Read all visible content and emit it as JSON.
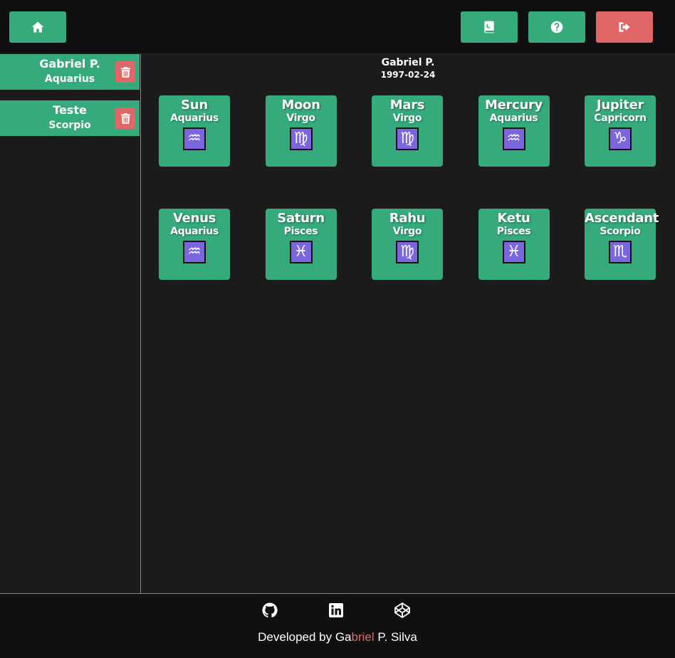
{
  "colors": {
    "accent_green": "#35aa7b",
    "danger_red": "#e06767",
    "sign_purple": "#7b66e0",
    "background": "#1b1b1b",
    "header_bg": "#101010"
  },
  "header": {
    "home_icon": "home-icon",
    "book_icon": "book-icon",
    "help_icon": "question-circle-icon",
    "logout_icon": "sign-out-icon"
  },
  "sidebar": {
    "people": [
      {
        "name": "Gabriel P.",
        "sign": "Aquarius",
        "delete_icon": "trash-icon"
      },
      {
        "name": "Teste",
        "sign": "Scorpio",
        "delete_icon": "trash-icon"
      }
    ]
  },
  "chart": {
    "name": "Gabriel P.",
    "date": "1997-02-24",
    "placements": [
      {
        "planet": "Sun",
        "sign": "Aquarius",
        "glyph": "♒"
      },
      {
        "planet": "Moon",
        "sign": "Virgo",
        "glyph": "♍"
      },
      {
        "planet": "Mars",
        "sign": "Virgo",
        "glyph": "♍"
      },
      {
        "planet": "Mercury",
        "sign": "Aquarius",
        "glyph": "♒"
      },
      {
        "planet": "Jupiter",
        "sign": "Capricorn",
        "glyph": "♑"
      },
      {
        "planet": "Venus",
        "sign": "Aquarius",
        "glyph": "♒"
      },
      {
        "planet": "Saturn",
        "sign": "Pisces",
        "glyph": "♓"
      },
      {
        "planet": "Rahu",
        "sign": "Virgo",
        "glyph": "♍"
      },
      {
        "planet": "Ketu",
        "sign": "Pisces",
        "glyph": "♓"
      },
      {
        "planet": "Ascendant",
        "sign": "Scorpio",
        "glyph": "♏"
      }
    ]
  },
  "footer": {
    "github_icon": "github-icon",
    "linkedin_icon": "linkedin-icon",
    "codepen_icon": "codepen-icon",
    "credit_prefix": "Developed by Ga",
    "credit_highlight": "briel",
    "credit_suffix": " P. Silva"
  }
}
